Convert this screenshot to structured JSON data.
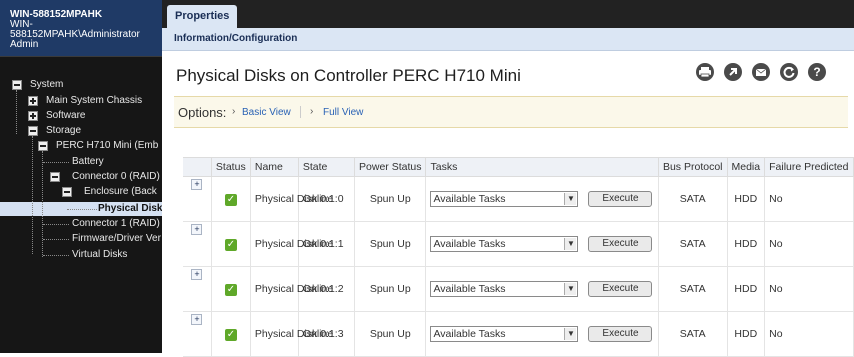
{
  "host": {
    "name": "WIN-588152MPAHK",
    "user_line": "WIN-588152MPAHK\\Administrator",
    "role": "Admin"
  },
  "tree": [
    {
      "label": "System"
    },
    {
      "label": "Main System Chassis"
    },
    {
      "label": "Software"
    },
    {
      "label": "Storage"
    },
    {
      "label": "PERC H710 Mini (Emb"
    },
    {
      "label": "Battery"
    },
    {
      "label": "Connector 0 (RAID)"
    },
    {
      "label": "Enclosure (Back"
    },
    {
      "label": "Physical Disk"
    },
    {
      "label": "Connector 1 (RAID)"
    },
    {
      "label": "Firmware/Driver Ver"
    },
    {
      "label": "Virtual Disks"
    }
  ],
  "tabs": {
    "properties": "Properties"
  },
  "subtab": "Information/Configuration",
  "page_title": "Physical Disks on Controller PERC H710 Mini",
  "toolbar_icons": [
    "print-icon",
    "export-icon",
    "email-icon",
    "refresh-icon",
    "help-icon"
  ],
  "options": {
    "label": "Options:",
    "basic": "Basic View",
    "full": "Full View"
  },
  "table": {
    "headers": [
      "",
      "Status",
      "Name",
      "State",
      "Power Status",
      "Tasks",
      "Bus Protocol",
      "Media",
      "Failure Predicted"
    ],
    "rows": [
      {
        "name": "Physical Disk 0:1:0",
        "state": "Online",
        "power": "Spun Up",
        "task": "Available Tasks",
        "exec": "Execute",
        "bus": "SATA",
        "media": "HDD",
        "failure": "No"
      },
      {
        "name": "Physical Disk 0:1:1",
        "state": "Online",
        "power": "Spun Up",
        "task": "Available Tasks",
        "exec": "Execute",
        "bus": "SATA",
        "media": "HDD",
        "failure": "No"
      },
      {
        "name": "Physical Disk 0:1:2",
        "state": "Online",
        "power": "Spun Up",
        "task": "Available Tasks",
        "exec": "Execute",
        "bus": "SATA",
        "media": "HDD",
        "failure": "No"
      },
      {
        "name": "Physical Disk 0:1:3",
        "state": "Online",
        "power": "Spun Up",
        "task": "Available Tasks",
        "exec": "Execute",
        "bus": "SATA",
        "media": "HDD",
        "failure": "No"
      }
    ]
  },
  "colors": {
    "accent": "#1f3a66",
    "status_ok": "#5fa829",
    "link": "#2a62b5"
  }
}
